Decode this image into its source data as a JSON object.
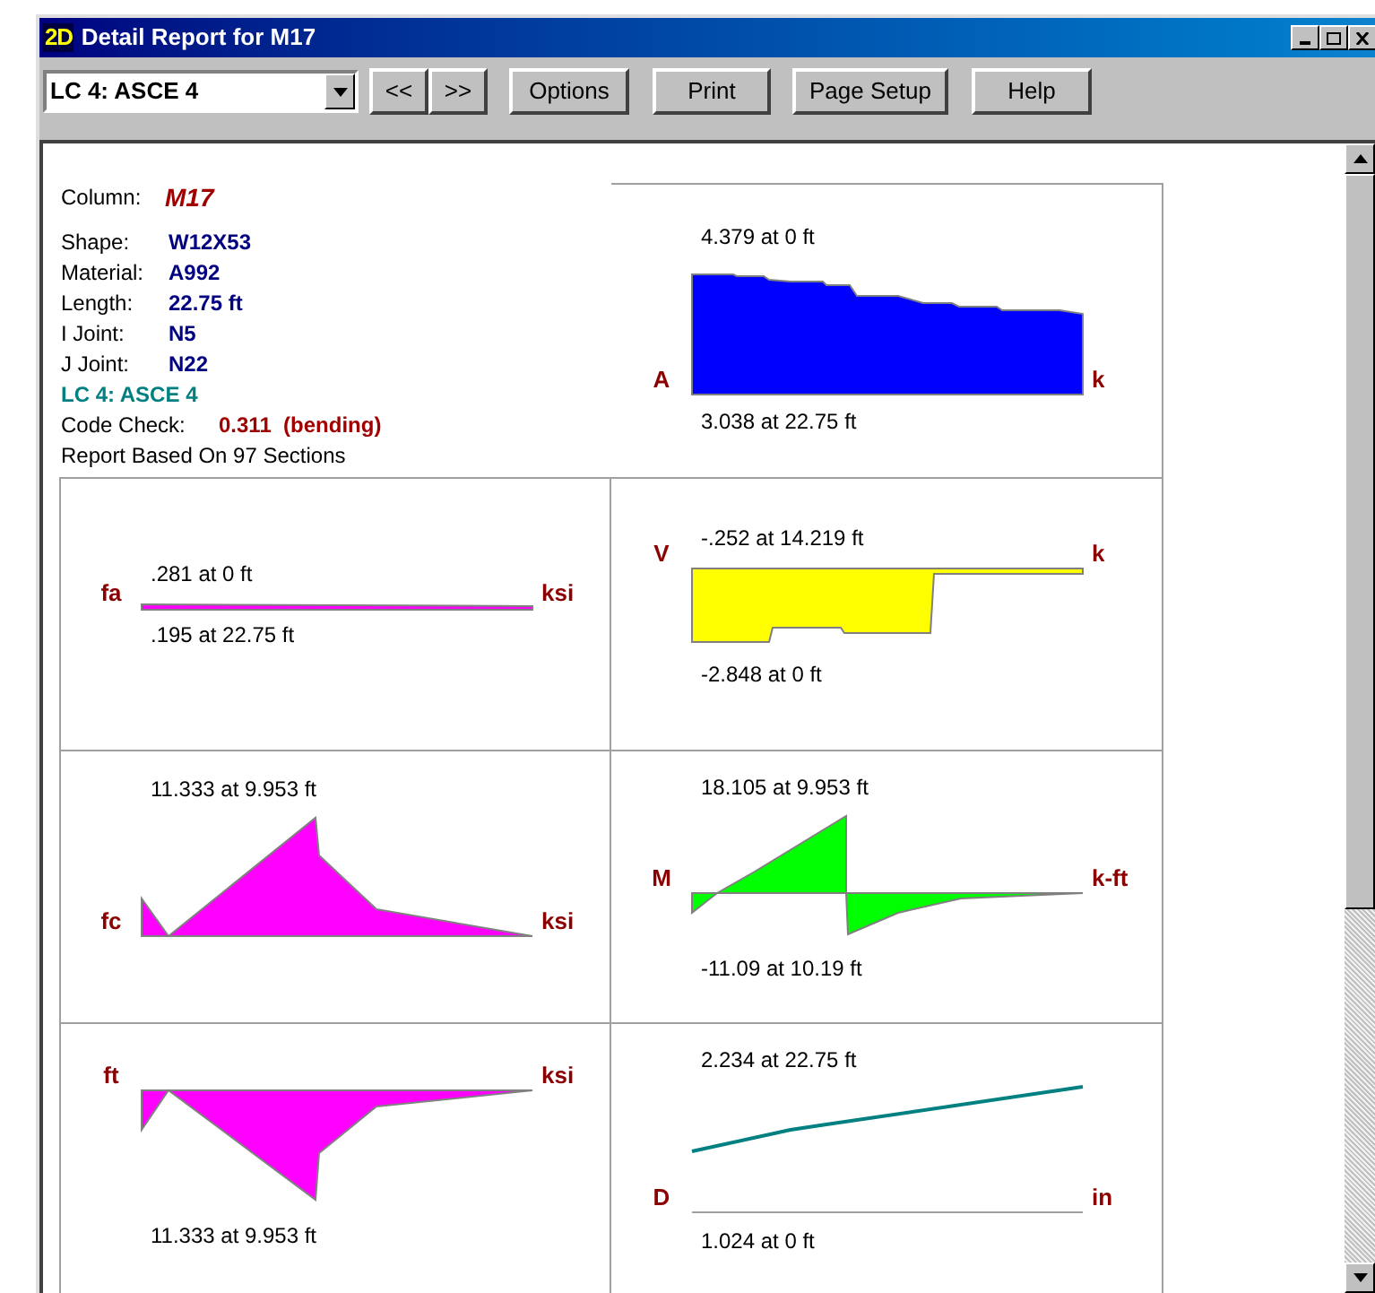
{
  "window": {
    "icon": "2D",
    "title": "Detail Report for M17"
  },
  "toolbar": {
    "load_case": "LC 4: ASCE 4",
    "buttons": [
      "<<",
      ">>",
      "Options",
      "Print",
      "Page Setup",
      "Help"
    ]
  },
  "info": {
    "column_label": "Column:",
    "column": "M17",
    "fields": [
      {
        "label": "Shape:",
        "value": "W12X53"
      },
      {
        "label": "Material:",
        "value": "A992"
      },
      {
        "label": "Length:",
        "value": "22.75 ft"
      },
      {
        "label": "I Joint:",
        "value": "N5"
      },
      {
        "label": "J Joint:",
        "value": "N22"
      }
    ],
    "load_case": "LC 4: ASCE 4",
    "code_check_label": "Code Check:",
    "code_check": "0.311  (bending)",
    "sections": "Report Based On 97 Sections"
  },
  "left_diagrams": [
    {
      "kind": "axial_stress",
      "symbol": "fa",
      "unit": "ksi",
      "top_label": ".281 at 0 ft",
      "bottom_label": ".195 at 22.75 ft",
      "color": "#ff00ff"
    },
    {
      "kind": "compression",
      "symbol": "fc",
      "unit": "ksi",
      "top_label": "11.333 at 9.953 ft",
      "color": "#ff00ff"
    },
    {
      "kind": "tension",
      "symbol": "ft",
      "unit": "ksi",
      "bottom_label": "11.333 at 9.953 ft",
      "color": "#ff00ff"
    }
  ],
  "right_diagrams": [
    {
      "kind": "axial",
      "symbol": "A",
      "unit": "k",
      "top_label": "4.379 at 0 ft",
      "bottom_label": "3.038 at 22.75 ft",
      "color": "#0000ff"
    },
    {
      "kind": "shear",
      "symbol": "V",
      "unit": "k",
      "top_label": "-.252 at 14.219 ft",
      "bottom_label": "-2.848 at 0 ft",
      "color": "#ffff00"
    },
    {
      "kind": "moment",
      "symbol": "M",
      "unit": "k-ft",
      "top_label": "18.105 at 9.953 ft",
      "bottom_label": "-11.09 at 10.19 ft",
      "color": "#00ff00"
    },
    {
      "kind": "deflection",
      "symbol": "D",
      "unit": "in",
      "top_label": "2.234 at 22.75 ft",
      "bottom_label": "1.024 at 0 ft",
      "color": "#008080"
    }
  ]
}
